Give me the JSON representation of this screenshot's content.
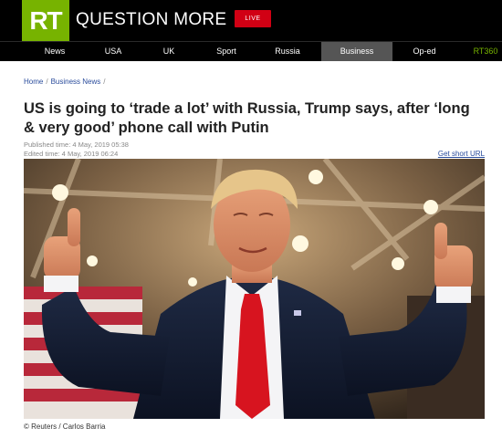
{
  "header": {
    "logo": "RT",
    "slogan": "QUESTION MORE",
    "live_label": "LIVE"
  },
  "nav": {
    "items": [
      "News",
      "USA",
      "UK",
      "Sport",
      "Russia",
      "Business",
      "Op-ed",
      "RT360"
    ],
    "active": "Business"
  },
  "breadcrumb": {
    "home": "Home",
    "section": "Business News",
    "separator": "/"
  },
  "article": {
    "headline": "US is going to ‘trade a lot’ with Russia, Trump says, after ‘long & very good’ phone call with Putin",
    "published": "Published time: 4 May, 2019 05:38",
    "edited": "Edited time: 4 May, 2019 06:24",
    "short_url_label": "Get short URL",
    "photo_caption": "© Reuters / Carlos Barria"
  },
  "colors": {
    "brand_green": "#77b300",
    "live_red": "#d10014",
    "link_blue": "#2a4c9c"
  }
}
